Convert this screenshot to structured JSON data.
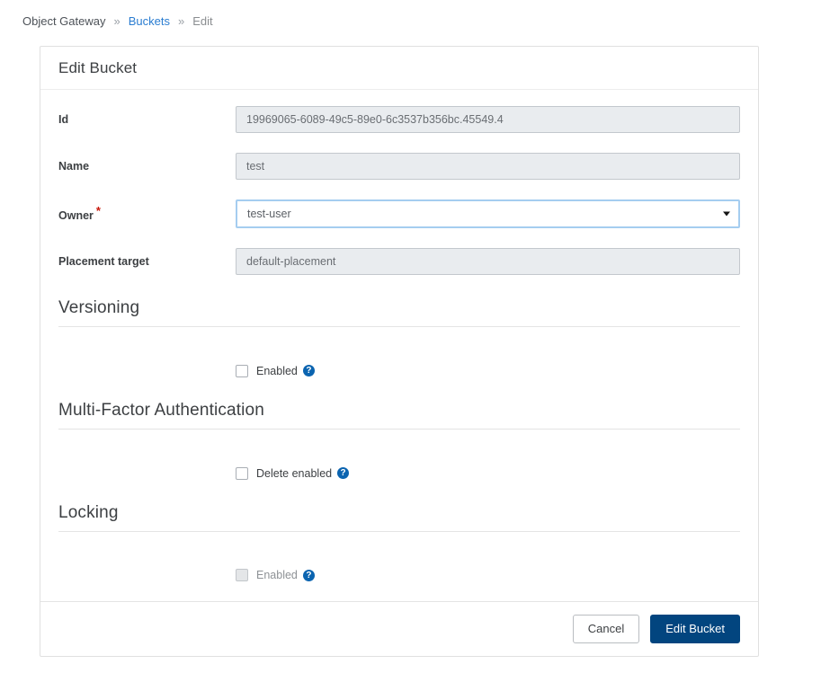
{
  "breadcrumb": {
    "items": [
      {
        "label": "Object Gateway",
        "type": "text"
      },
      {
        "label": "Buckets",
        "type": "link"
      },
      {
        "label": "Edit",
        "type": "muted"
      }
    ],
    "separator": "»"
  },
  "card": {
    "title": "Edit Bucket"
  },
  "form": {
    "id": {
      "label": "Id",
      "value": "19969065-6089-49c5-89e0-6c3537b356bc.45549.4",
      "readonly": true
    },
    "name": {
      "label": "Name",
      "value": "test",
      "readonly": true
    },
    "owner": {
      "label": "Owner",
      "required_marker": "*",
      "value": "test-user",
      "options": [
        "test-user"
      ]
    },
    "placement_target": {
      "label": "Placement target",
      "value": "default-placement",
      "readonly": true
    }
  },
  "sections": {
    "versioning": {
      "title": "Versioning",
      "checkbox_label": "Enabled",
      "checked": false,
      "disabled": false,
      "help_icon": "help-circle-icon",
      "help_glyph": "?"
    },
    "mfa": {
      "title": "Multi-Factor Authentication",
      "checkbox_label": "Delete enabled",
      "checked": false,
      "disabled": false,
      "help_icon": "help-circle-icon",
      "help_glyph": "?"
    },
    "locking": {
      "title": "Locking",
      "checkbox_label": "Enabled",
      "checked": false,
      "disabled": true,
      "help_icon": "help-circle-icon",
      "help_glyph": "?"
    }
  },
  "footer": {
    "cancel_label": "Cancel",
    "submit_label": "Edit Bucket"
  },
  "colors": {
    "primary_button": "#02457f",
    "link": "#2b7dd1",
    "required_star": "#c9190b",
    "help_icon": "#0b64b0",
    "readonly_field_bg": "#e9ecef",
    "focus_border": "#a5cdf0"
  }
}
